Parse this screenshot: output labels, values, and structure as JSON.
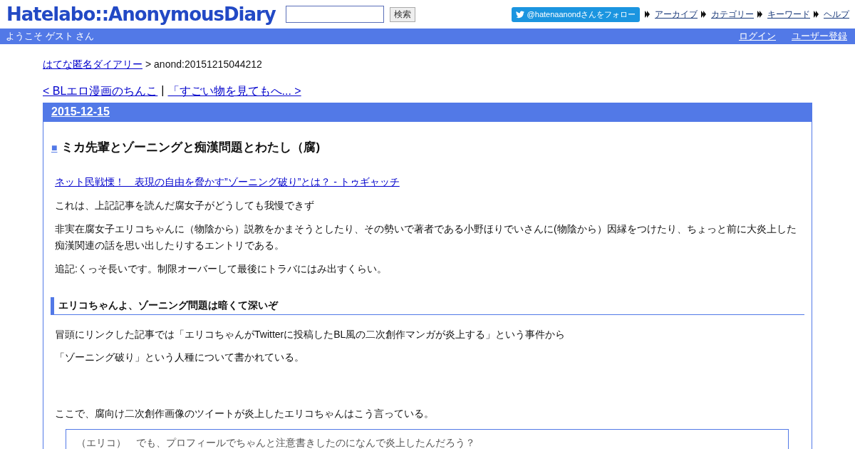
{
  "header": {
    "logo": "Hatelabo::AnonymousDiary",
    "search": {
      "button": "検索"
    },
    "follow_button": "@hatenaanondさんをフォロー",
    "nav": [
      "アーカイブ",
      "カテゴリー",
      "キーワード",
      "ヘルプ"
    ]
  },
  "user_bar": {
    "greeting": "ようこそ ゲスト さん",
    "links": [
      "ログイン",
      "ユーザー登録"
    ]
  },
  "breadcrumb": {
    "link": "はてな匿名ダイアリー",
    "current": "> anond:20151215044212"
  },
  "pager": {
    "prev": "< BLエロ漫画のちんこ",
    "separator": "|",
    "next": "「すごい物を見てもへ... >"
  },
  "day": {
    "date": "2015-12-15",
    "entry": {
      "marker": "■",
      "title": "ミカ先輩とゾーニングと痴漢問題とわたし（腐)",
      "source_link": "ネット民戦慄！　表現の自由を脅かす”ゾーニング破り”とは？ - トゥギャッチ",
      "paragraphs": [
        "これは、上記記事を読んだ腐女子がどうしても我慢できず",
        "非実在腐女子エリコちゃんに（物陰から）説教をかまそうとしたり、その勢いで著者である小野ほりでいさんに(物陰から）因縁をつけたり、ちょっと前に大炎上した痴漢関連の話を思い出したりするエントリである。",
        "追記:くっそ長いです。制限オーバーして最後にトラバにはみ出すくらい。"
      ],
      "section_heading": "エリコちゃんよ、ゾーニング問題は暗くて深いぞ",
      "section_paragraphs": [
        "冒頭にリンクした記事では「エリコちゃんがTwitterに投稿したBL風の二次創作マンガが炎上する」という事件から",
        "「ゾーニング破り」という人種について書かれている。",
        "ここで、腐向け二次創作画像のツイートが炎上したエリコちゃんはこう言っている。"
      ],
      "quote": "（エリコ）　でも、プロフィールでちゃんと注意書きしたのになんで炎上したんだろう？"
    }
  }
}
